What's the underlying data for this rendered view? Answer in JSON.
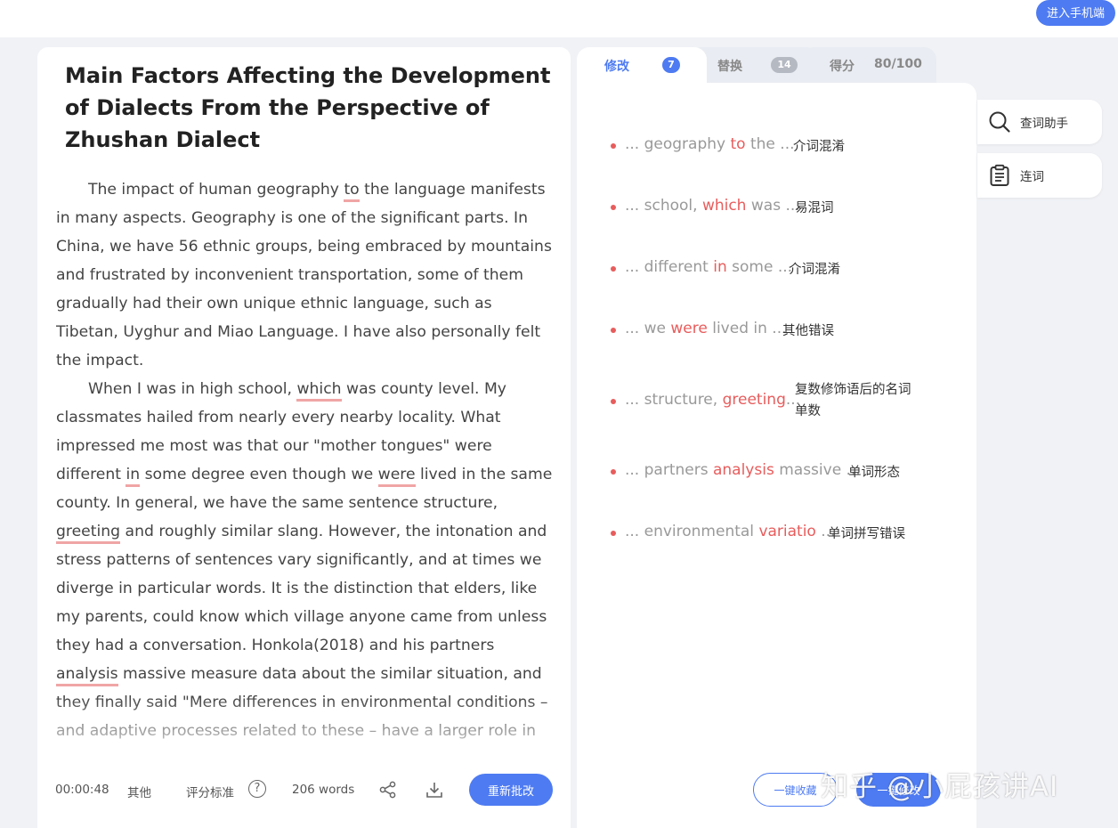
{
  "header": {
    "mobile_button": "进入手机端"
  },
  "essay": {
    "title": "Main Factors Affecting the Development of Dialects From the Perspective of Zhushan Dialect",
    "p1": [
      "The impact of human geography ",
      "to",
      " the language manifests in many aspects. Geography is one of the significant parts. In China, we have 56 ethnic groups, being embraced by mountains and frustrated by inconvenient transportation, some of them gradually had their own unique ethnic language, such as Tibetan, Uyghur and Miao Language. I have also personally felt the impact."
    ],
    "p2": [
      "When I was in high school, ",
      "which",
      " was county level. My classmates hailed from nearly every nearby locality. What impressed me most was that our \"mother tongues\" were different ",
      "in",
      " some degree even though we ",
      "were",
      " lived in the same county. In general, we have the same sentence structure, ",
      "greeting",
      " and roughly similar slang. However, the intonation and stress patterns of sentences vary significantly, and at times we diverge in particular words. It is the distinction that elders, like my parents, could know which village anyone came from unless they had a conversation. Honkola(2018) and his partners ",
      "analysis",
      " massive measure data about the similar situation, and they finally said \"Mere differences in environmental conditions – and adaptive processes related to these – have a larger role in"
    ]
  },
  "footer": {
    "timer": "00:00:48",
    "category": "其他",
    "criteria": "评分标准",
    "help": "?",
    "word_count": "206 words",
    "recheck": "重新批改"
  },
  "tabs": {
    "revise": "修改",
    "revise_count": "7",
    "replace": "替换",
    "replace_count": "14",
    "score_label": "得分",
    "score_value": "80/100"
  },
  "issues": [
    {
      "pre": "... geography ",
      "word": "to",
      "post": " the ...",
      "type": "介词混淆"
    },
    {
      "pre": "... school, ",
      "word": "which",
      "post": " was ...",
      "type": "易混词"
    },
    {
      "pre": "... different ",
      "word": "in",
      "post": " some ...",
      "type": "介词混淆"
    },
    {
      "pre": "... we ",
      "word": "were",
      "post": " lived in ...",
      "type": "其他错误"
    },
    {
      "pre": "... structure, ",
      "word": "greeting",
      "post": "...",
      "type": "复数修饰语后的名词单数"
    },
    {
      "pre": "... partners ",
      "word": "analysis",
      "post": " massive ...",
      "type": "单词形态"
    },
    {
      "pre": "... environmental ",
      "word": "variatio",
      "post": " ...",
      "type": "单词拼写错误"
    }
  ],
  "actions": {
    "collect": "一键收藏",
    "fix": "一键修改"
  },
  "tools": {
    "lookup": "查词助手",
    "connect": "连词"
  },
  "watermark": "知乎 @小屁孩讲AI",
  "colors": {
    "accent": "#4e7bf2",
    "error": "#e85c5c",
    "underline": "#f0a5a5"
  }
}
